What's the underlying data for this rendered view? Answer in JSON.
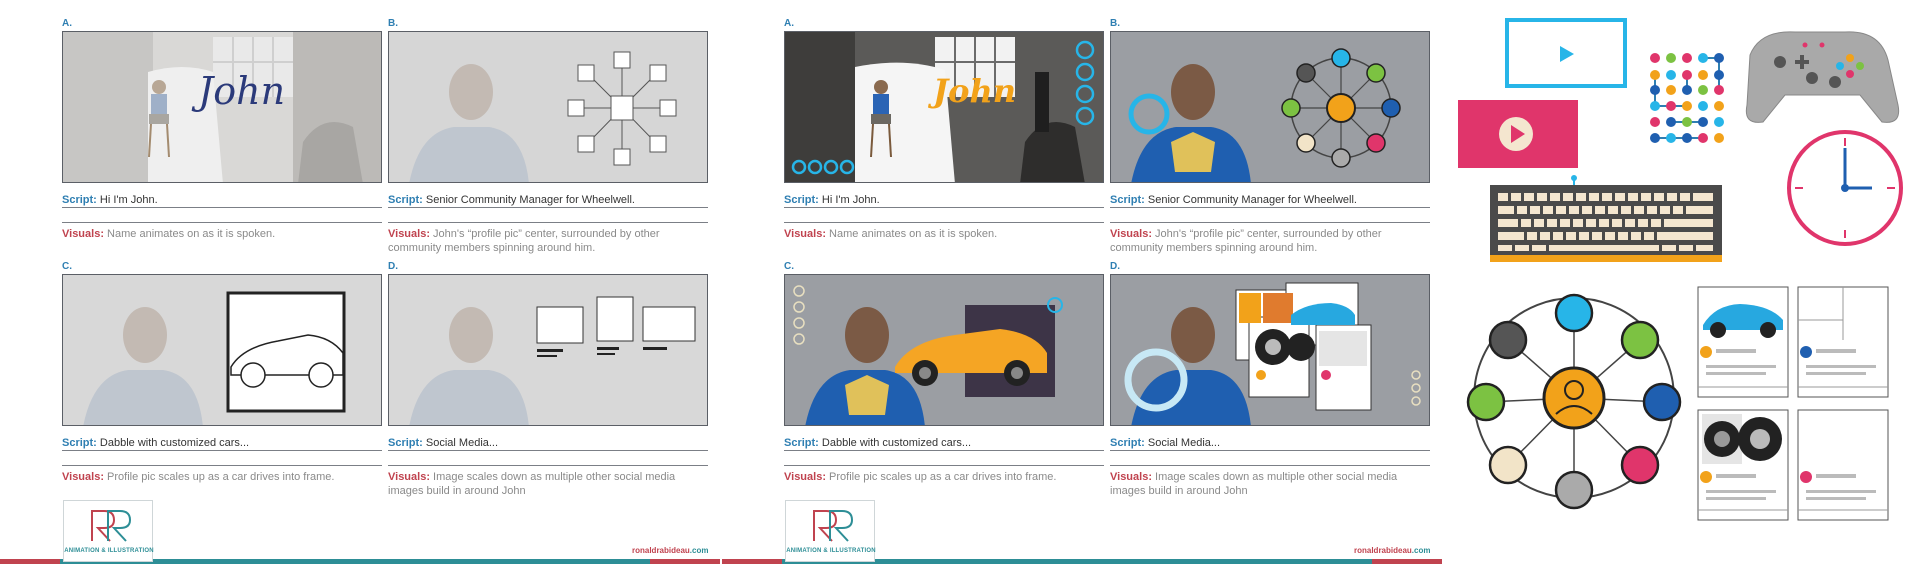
{
  "site": {
    "name": "ronaldrabideau",
    "tld": ".com"
  },
  "logo": {
    "subtitle": "ANIMATION & ILLUSTRATION"
  },
  "boards": [
    {
      "panels": [
        {
          "letter": "A.",
          "script_label": "Script:",
          "script": " Hi I'm John.",
          "visuals_label": "Visuals:",
          "visuals": " Name animates on as it is spoken.",
          "overlay_text": "John"
        },
        {
          "letter": "B.",
          "script_label": "Script:",
          "script": " Senior Community Manager for Wheelwell.",
          "visuals_label": "Visuals:",
          "visuals": " John's “profile pic” center, surrounded by other community members spinning around him."
        },
        {
          "letter": "C.",
          "script_label": "Script:",
          "script": " Dabble with customized cars...",
          "visuals_label": "Visuals:",
          "visuals": " Profile pic scales up as a car drives into frame."
        },
        {
          "letter": "D.",
          "script_label": "Script:",
          "script": " Social Media...",
          "visuals_label": "Visuals:",
          "visuals": " Image scales down as multiple other social media images build in around John"
        }
      ]
    },
    {
      "panels": [
        {
          "letter": "A.",
          "script_label": "Script:",
          "script": " Hi I'm John.",
          "visuals_label": "Visuals:",
          "visuals": " Name animates on as it is spoken.",
          "overlay_text": "John"
        },
        {
          "letter": "B.",
          "script_label": "Script:",
          "script": " Senior Community Manager for Wheelwell.",
          "visuals_label": "Visuals:",
          "visuals": " John's “profile pic” center, surrounded by other community members spinning around him."
        },
        {
          "letter": "C.",
          "script_label": "Script:",
          "script": " Dabble with customized cars...",
          "visuals_label": "Visuals:",
          "visuals": " Profile pic scales up as a car drives into frame."
        },
        {
          "letter": "D.",
          "script_label": "Script:",
          "script": " Social Media...",
          "visuals_label": "Visuals:",
          "visuals": " Image scales down as multiple other social media images build in around John"
        }
      ]
    }
  ],
  "colors": {
    "blue": "#2f7fb2",
    "red": "#c0434f",
    "teal": "#2d8e96",
    "cyan": "#27b5e8",
    "pink": "#e0356b",
    "orange": "#f2a21a"
  },
  "icons": [
    "video-player-icon",
    "play-button-icon",
    "dot-network-icon",
    "game-controller-icon",
    "clock-icon",
    "keyboard-icon",
    "community-network-icon",
    "social-cards-icon"
  ]
}
